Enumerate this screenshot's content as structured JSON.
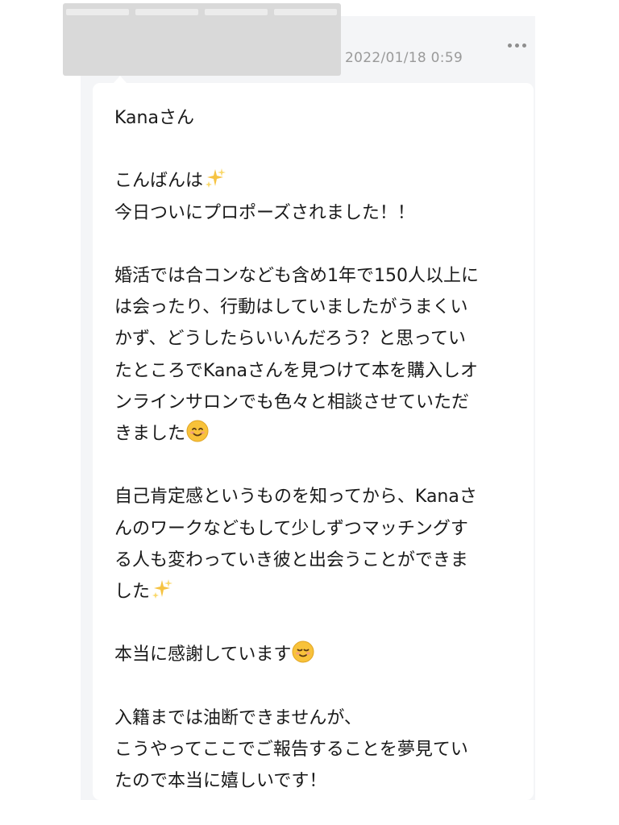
{
  "message": {
    "timestamp": "2022/01/18 0:59",
    "lines": [
      "Kanaさん",
      "",
      "こんばんは",
      "今日ついにプロポーズされました！！",
      "",
      "婚活では合コンなども含め1年で150人以上に",
      "は会ったり、行動はしていましたがうまくい",
      "かず、どうしたらいいんだろう？と思ってい",
      "たところでKanaさんを見つけて本を購入しオ",
      "ンラインサロンでも色々と相談させていただ",
      "きました",
      "",
      "自己肯定感というものを知ってから、Kanaさ",
      "んのワークなどもして少しずつマッチングす",
      "る人も変わっていき彼と出会うことができま",
      "した",
      "",
      "本当に感謝しています",
      "",
      "入籍までは油断できませんが、",
      "こうやってここでご報告することを夢見てい",
      "たので本当に嬉しいです！"
    ],
    "emojis": {
      "sparkles": "sparkles-emoji",
      "smiling_face": "smiling-face-emoji",
      "relieved_face": "relieved-face-emoji"
    }
  },
  "colors": {
    "panel_background": "#f4f5f7",
    "bubble_background": "#ffffff",
    "redaction": "#d9d9d9",
    "timestamp_text": "#9a9a9a",
    "message_text": "#1a1a1a"
  }
}
